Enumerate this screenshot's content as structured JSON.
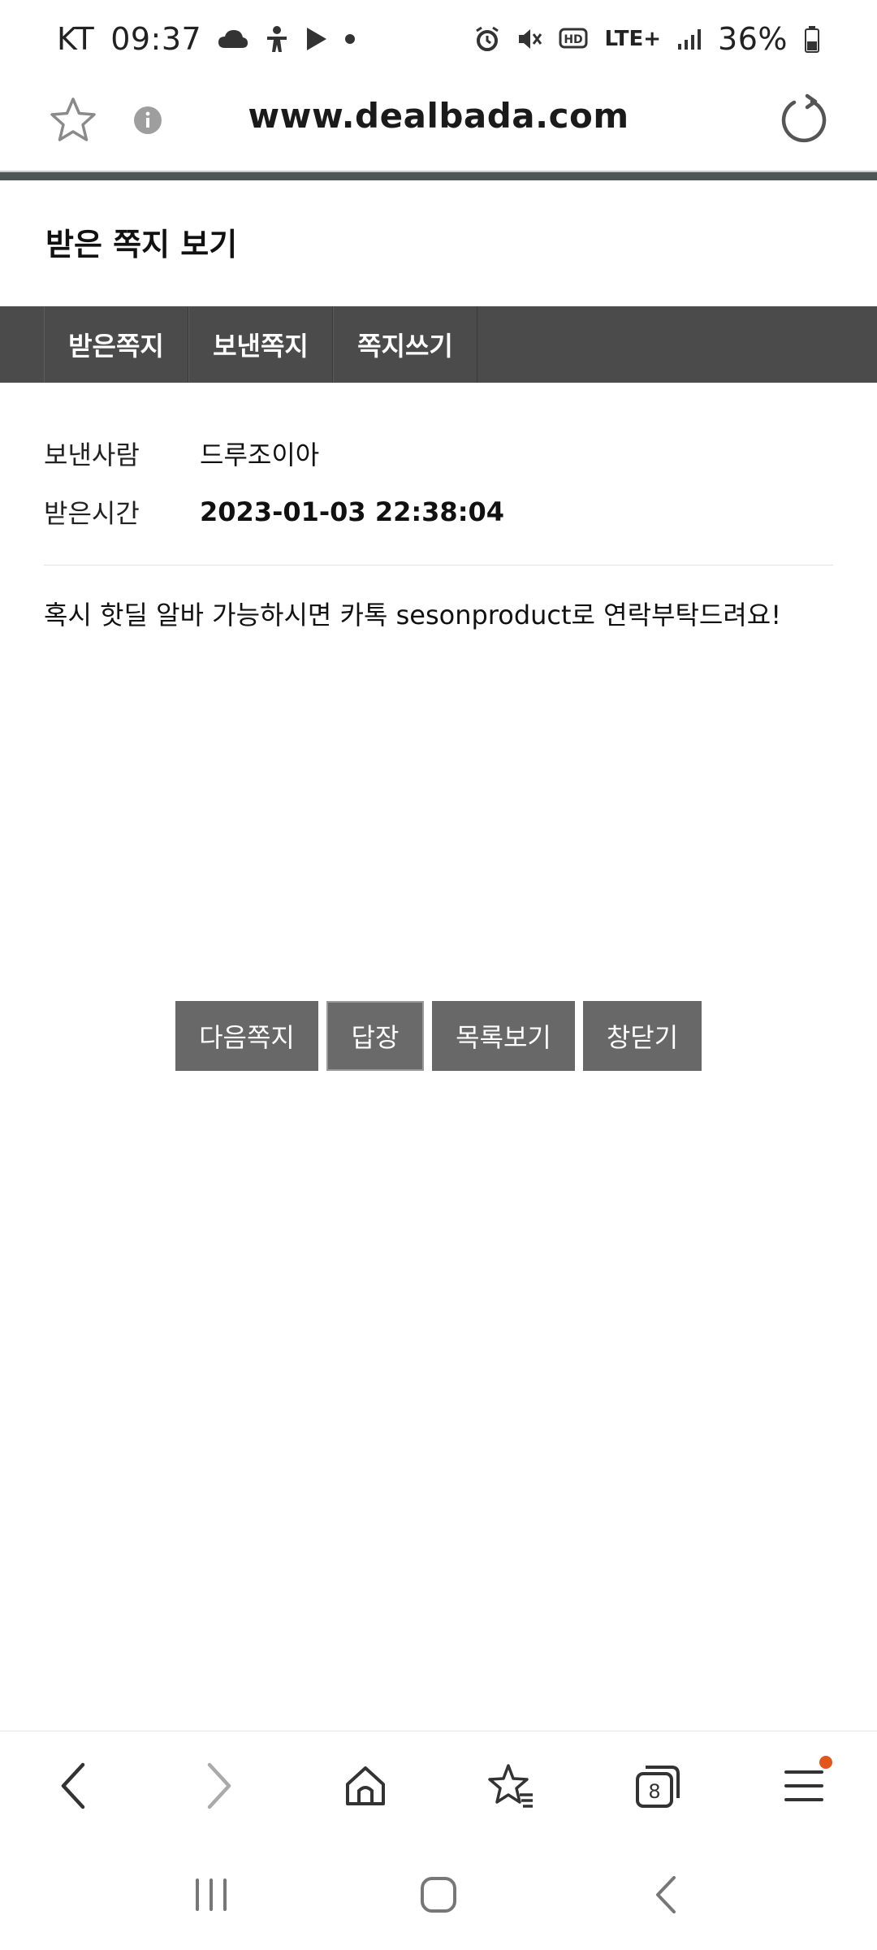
{
  "status_bar": {
    "carrier": "KT",
    "time": "09:37",
    "network": "LTE+",
    "battery": "36%"
  },
  "browser": {
    "url": "www.dealbada.com"
  },
  "page": {
    "title": "받은 쪽지 보기",
    "tabs": [
      {
        "label": "받은쪽지"
      },
      {
        "label": "보낸쪽지"
      },
      {
        "label": "쪽지쓰기"
      }
    ],
    "sender_label": "보낸사람",
    "sender_value": "드루조이아",
    "received_label": "받은시간",
    "received_value": "2023-01-03 22:38:04",
    "message": "혹시 핫딜 알바 가능하시면 카톡 sesonproduct로 연락부탁드려요!",
    "buttons": {
      "next": "다음쪽지",
      "reply": "답장",
      "list": "목록보기",
      "close": "창닫기"
    }
  },
  "toolbar": {
    "tab_count": "8",
    "icons": [
      "back-icon",
      "forward-icon",
      "home-icon",
      "bookmarks-icon",
      "tabs-icon",
      "menu-icon"
    ]
  },
  "colors": {
    "nav_bar": "#4b4b4b",
    "button": "#686868",
    "notification_dot": "#e2561d"
  }
}
